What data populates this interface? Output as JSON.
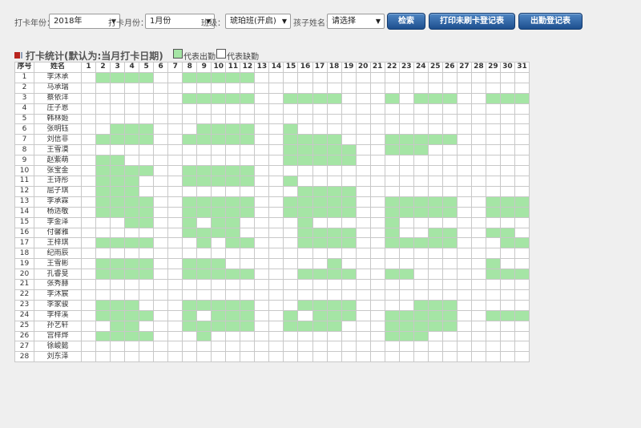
{
  "toolbar": {
    "year_label": "打卡年份：",
    "year_value": "2018年",
    "month_label": "打卡月份：",
    "month_value": "1月份",
    "class_label": "班级：",
    "class_value": "琥珀班(开启)",
    "child_label": "孩子姓名：",
    "child_value": "请选择",
    "search_label": "检索",
    "print_label": "打印未刷卡登记表",
    "register_label": "出勤登记表"
  },
  "section": {
    "title": "打卡统计(默认为:当月打卡日期)",
    "legend_present": "代表出勤",
    "legend_absent": "代表缺勤"
  },
  "colors": {
    "present": "#a5e5a5",
    "button": "#2a5fa0",
    "accent_mark": "#b8241e"
  },
  "table": {
    "col_index": "序号",
    "col_name": "姓名",
    "days": [
      1,
      2,
      3,
      4,
      5,
      6,
      7,
      8,
      9,
      10,
      11,
      12,
      13,
      14,
      15,
      16,
      17,
      18,
      19,
      20,
      21,
      22,
      23,
      24,
      25,
      26,
      27,
      28,
      29,
      30,
      31
    ],
    "rows": [
      {
        "index": "1",
        "name": "李沐承",
        "present": [
          2,
          3,
          4,
          5,
          8,
          9,
          10,
          11,
          12
        ]
      },
      {
        "index": "2",
        "name": "马承瑞",
        "present": []
      },
      {
        "index": "3",
        "name": "蔡依洋",
        "present": [
          8,
          9,
          10,
          11,
          12,
          15,
          16,
          17,
          18,
          22,
          24,
          25,
          26,
          29,
          30,
          31
        ]
      },
      {
        "index": "4",
        "name": "庄子恩",
        "present": []
      },
      {
        "index": "5",
        "name": "韩林姬",
        "present": []
      },
      {
        "index": "6",
        "name": "张明钰",
        "present": [
          3,
          4,
          5,
          9,
          10,
          11,
          12,
          15
        ]
      },
      {
        "index": "7",
        "name": "刘信非",
        "present": [
          2,
          3,
          4,
          5,
          8,
          9,
          10,
          11,
          12,
          15,
          16,
          17,
          18,
          22,
          23,
          24,
          25,
          26
        ]
      },
      {
        "index": "8",
        "name": "王雪漠",
        "present": [
          15,
          16,
          17,
          18,
          19,
          22,
          23,
          24
        ]
      },
      {
        "index": "9",
        "name": "赵紫萌",
        "present": [
          2,
          3,
          15,
          16,
          17,
          18,
          19
        ]
      },
      {
        "index": "10",
        "name": "张宝金",
        "present": [
          2,
          3,
          4,
          5,
          8,
          9,
          10,
          11,
          12
        ]
      },
      {
        "index": "11",
        "name": "王诗彤",
        "present": [
          2,
          3,
          4,
          8,
          9,
          10,
          11,
          12,
          15
        ]
      },
      {
        "index": "12",
        "name": "屈子琪",
        "present": [
          2,
          3,
          4,
          16,
          17,
          18,
          19
        ]
      },
      {
        "index": "13",
        "name": "李承霖",
        "present": [
          2,
          3,
          4,
          5,
          8,
          9,
          10,
          11,
          12,
          15,
          16,
          17,
          18,
          19,
          22,
          23,
          24,
          25,
          26,
          29,
          30,
          31
        ]
      },
      {
        "index": "14",
        "name": "杨适敬",
        "present": [
          2,
          3,
          4,
          5,
          8,
          9,
          10,
          11,
          12,
          15,
          16,
          17,
          18,
          19,
          22,
          23,
          24,
          25,
          26,
          29,
          30,
          31
        ]
      },
      {
        "index": "15",
        "name": "李金泽",
        "present": [
          4,
          5,
          8,
          10,
          11,
          16,
          22
        ]
      },
      {
        "index": "16",
        "name": "付馨雅",
        "present": [
          8,
          9,
          10,
          11,
          16,
          17,
          18,
          19,
          22,
          25,
          26,
          29,
          30
        ]
      },
      {
        "index": "17",
        "name": "王梓琪",
        "present": [
          2,
          3,
          4,
          5,
          9,
          11,
          12,
          16,
          17,
          18,
          19,
          22,
          23,
          24,
          25,
          26,
          30,
          31
        ]
      },
      {
        "index": "18",
        "name": "纪雨辰",
        "present": []
      },
      {
        "index": "19",
        "name": "王雪彬",
        "present": [
          2,
          3,
          4,
          5,
          8,
          9,
          10,
          18,
          29
        ]
      },
      {
        "index": "20",
        "name": "孔睿旻",
        "present": [
          2,
          3,
          4,
          5,
          8,
          9,
          10,
          11,
          12,
          16,
          17,
          18,
          19,
          22,
          23,
          29,
          30,
          31
        ]
      },
      {
        "index": "21",
        "name": "张秀赫",
        "present": []
      },
      {
        "index": "22",
        "name": "李沐宸",
        "present": []
      },
      {
        "index": "23",
        "name": "李家骏",
        "present": [
          2,
          3,
          4,
          8,
          9,
          10,
          11,
          12,
          16,
          17,
          18,
          19,
          24,
          25,
          26
        ]
      },
      {
        "index": "24",
        "name": "李梓溪",
        "present": [
          2,
          3,
          4,
          5,
          8,
          10,
          11,
          12,
          15,
          17,
          18,
          19,
          22,
          23,
          24,
          25,
          26,
          29,
          30,
          31
        ]
      },
      {
        "index": "25",
        "name": "孙艺轩",
        "present": [
          3,
          4,
          8,
          9,
          10,
          11,
          12,
          15,
          16,
          17,
          18,
          22,
          23,
          24,
          25,
          26
        ]
      },
      {
        "index": "26",
        "name": "宫梓烨",
        "present": [
          2,
          3,
          4,
          5,
          9,
          22,
          23,
          24
        ]
      },
      {
        "index": "27",
        "name": "徐峻懿",
        "present": []
      },
      {
        "index": "28",
        "name": "刘东泽",
        "present": []
      }
    ]
  }
}
